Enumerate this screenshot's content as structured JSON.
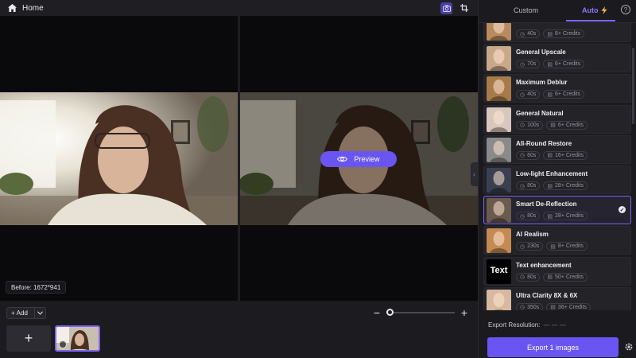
{
  "topbar": {
    "home_label": "Home",
    "tools": [
      {
        "icon": "camera-icon",
        "active": true
      },
      {
        "icon": "crop-icon",
        "active": false
      }
    ]
  },
  "canvas": {
    "preview_label": "Preview",
    "before_label": "Before: 1672*941"
  },
  "bottom": {
    "add_label": "Add",
    "add_plus": "+",
    "zoom_minus": "−",
    "zoom_plus": "+",
    "zoom_level": 0.05,
    "new_tile_plus": "+"
  },
  "panel": {
    "tabs": [
      {
        "label": "Custom",
        "active": false
      },
      {
        "label": "Auto",
        "active": true
      }
    ],
    "help_glyph": "?",
    "models": [
      {
        "title": "",
        "time": "40s",
        "credits": "8+ Credits",
        "color": "#b88a5f",
        "partial": true
      },
      {
        "title": "General Upscale",
        "time": "70s",
        "credits": "6+ Credits",
        "color": "#c9a88a"
      },
      {
        "title": "Maximum Deblur",
        "time": "40s",
        "credits": "6+ Credits",
        "color": "#a87a4a"
      },
      {
        "title": "General Natural",
        "time": "100s",
        "credits": "6+ Credits",
        "color": "#d9c7bd"
      },
      {
        "title": "All-Round Restore",
        "time": "60s",
        "credits": "16+ Credits",
        "color": "#8a8a8a"
      },
      {
        "title": "Low-light Enhancement",
        "time": "80s",
        "credits": "28+ Credits",
        "color": "#3a4050"
      },
      {
        "title": "Smart De-Reflection",
        "time": "80s",
        "credits": "28+ Credits",
        "color": "#6b5a4e",
        "selected": true
      },
      {
        "title": "AI Realism",
        "time": "230s",
        "credits": "8+ Credits",
        "color": "#c48a52"
      },
      {
        "title": "Text enhancement",
        "time": "80s",
        "credits": "50+ Credits",
        "color": "#000000",
        "thumb_text": "Text"
      },
      {
        "title": "Ultra Clarity 8X & 6X",
        "time": "350s",
        "credits": "36+ Credits",
        "color": "#d8b8a0"
      }
    ],
    "export_resolution_label": "Export Resolution:",
    "export_resolution_value": "--- --- ---",
    "export_button_label": "Export 1 images"
  },
  "colors": {
    "accent": "#6b55f2",
    "accent_light": "#8b78ff",
    "panel_bg": "#1b1b1f"
  }
}
